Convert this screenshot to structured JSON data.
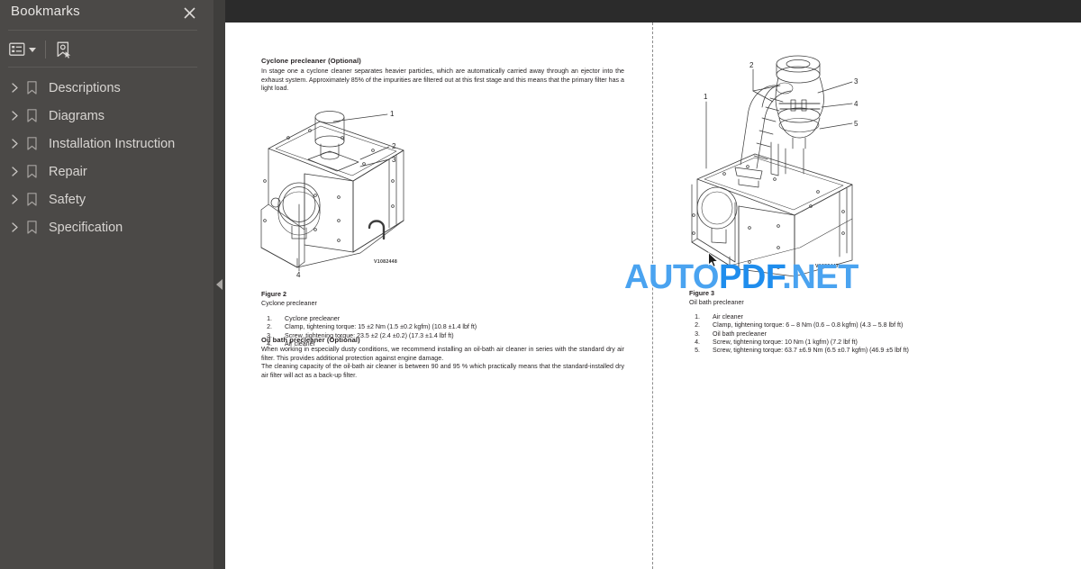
{
  "sidebar": {
    "title": "Bookmarks",
    "close_icon": "close-icon",
    "toolbar": {
      "options_label": "bookmark-options",
      "options_icon": "list-options-icon",
      "new_bookmark_label": "new-bookmark",
      "new_bookmark_icon": "add-bookmark-icon"
    },
    "items": [
      {
        "label": "Descriptions",
        "icon": "bookmark-icon",
        "expander": "chevron-right-icon"
      },
      {
        "label": "Diagrams",
        "icon": "bookmark-icon",
        "expander": "chevron-right-icon"
      },
      {
        "label": "Installation Instruction",
        "icon": "bookmark-icon",
        "expander": "chevron-right-icon"
      },
      {
        "label": "Repair",
        "icon": "bookmark-icon",
        "expander": "chevron-right-icon"
      },
      {
        "label": "Safety",
        "icon": "bookmark-icon",
        "expander": "chevron-right-icon"
      },
      {
        "label": "Specification",
        "icon": "bookmark-icon",
        "expander": "chevron-right-icon"
      }
    ]
  },
  "splitter": {
    "collapse_icon": "chevron-left-icon"
  },
  "watermark": {
    "part1": "AUTO",
    "part2": "PDF",
    "part3": ".NET",
    "color": "#3a9bf0"
  },
  "left_page": {
    "section1_heading": "Cyclone precleaner (Optional)",
    "section1_body": "In stage one a cyclone cleaner separates heavier particles, which are automatically carried away through an ejector into the exhaust system. Approximately 85% of the impurities are filtered out at this first stage and this means that the primary filter has a light load.",
    "figure_id": "V1082448",
    "figure_title": "Figure 2",
    "figure_subtitle": "Cyclone precleaner",
    "figure_callouts": [
      "1",
      "2",
      "3",
      "4"
    ],
    "figure_items": [
      {
        "n": "1.",
        "text": "Cyclone precleaner"
      },
      {
        "n": "2.",
        "text": "Clamp, tightening torque: 15 ±2 Nm (1.5 ±0.2 kgfm) (10.8 ±1.4 lbf ft)"
      },
      {
        "n": "3.",
        "text": "Screw, tightening torque: 23.5 ±2 (2.4 ±0.2) (17.3 ±1.4 lbf ft)"
      },
      {
        "n": "4.",
        "text": "Air cleaner"
      }
    ],
    "section2_heading": "Oil bath precleaner (Optional)",
    "section2_body_p1": "When working in especially dusty conditions, we recommend installing an oil-bath air cleaner in series with the standard dry air filter. This provides additional protection against engine damage.",
    "section2_body_p2": "The cleaning capacity of the oil-bath air cleaner is between 90 and 95 % which practically means that the standard-installed dry air filter will act as a back-up filter."
  },
  "right_page": {
    "figure_id": "V1082447",
    "figure_title": "Figure 3",
    "figure_subtitle": "Oil bath precleaner",
    "figure_callouts": [
      "1",
      "2",
      "3",
      "4",
      "5"
    ],
    "figure_items": [
      {
        "n": "1.",
        "text": "Air cleaner"
      },
      {
        "n": "2.",
        "text": "Clamp, tightening torque: 6 – 8 Nm (0.6 – 0.8 kgfm) (4.3 – 5.8 lbf ft)"
      },
      {
        "n": "3.",
        "text": "Oil bath precleaner"
      },
      {
        "n": "4.",
        "text": "Screw, tightening torque: 10 Nm (1 kgfm) (7.2 lbf ft)"
      },
      {
        "n": "5.",
        "text": "Screw, tightening torque: 63.7 ±6.9 Nm (6.5 ±0.7 kgfm) (46.9 ±5 lbf ft)"
      }
    ]
  }
}
